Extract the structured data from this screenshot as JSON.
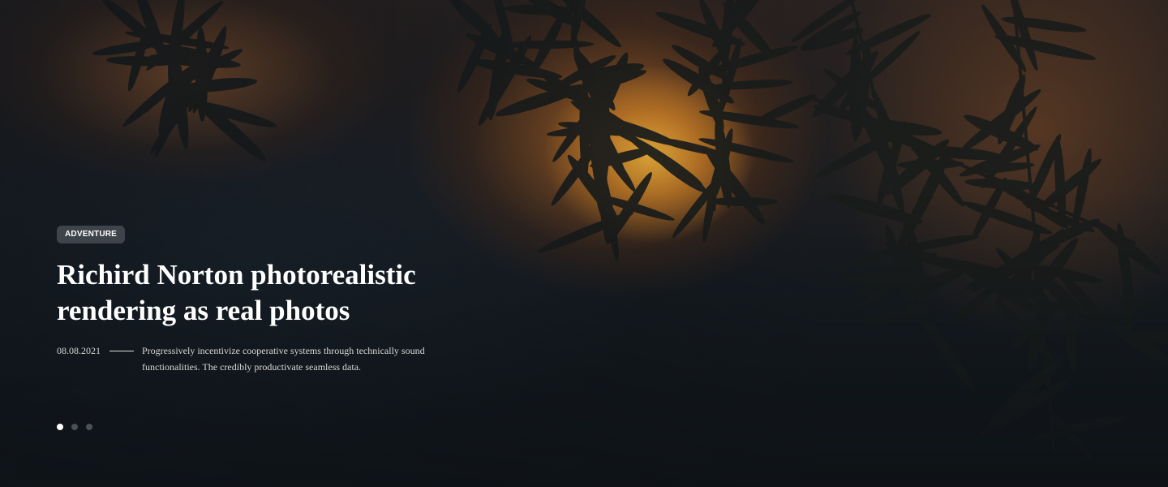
{
  "hero": {
    "category": "ADVENTURE",
    "title": "Richird Norton photorealistic rendering as real photos",
    "date": "08.08.2021",
    "description": "Progressively incentivize cooperative systems through technically sound functionalities. The credibly productivate seamless data.",
    "slides": {
      "count": 3,
      "active": 1
    }
  }
}
